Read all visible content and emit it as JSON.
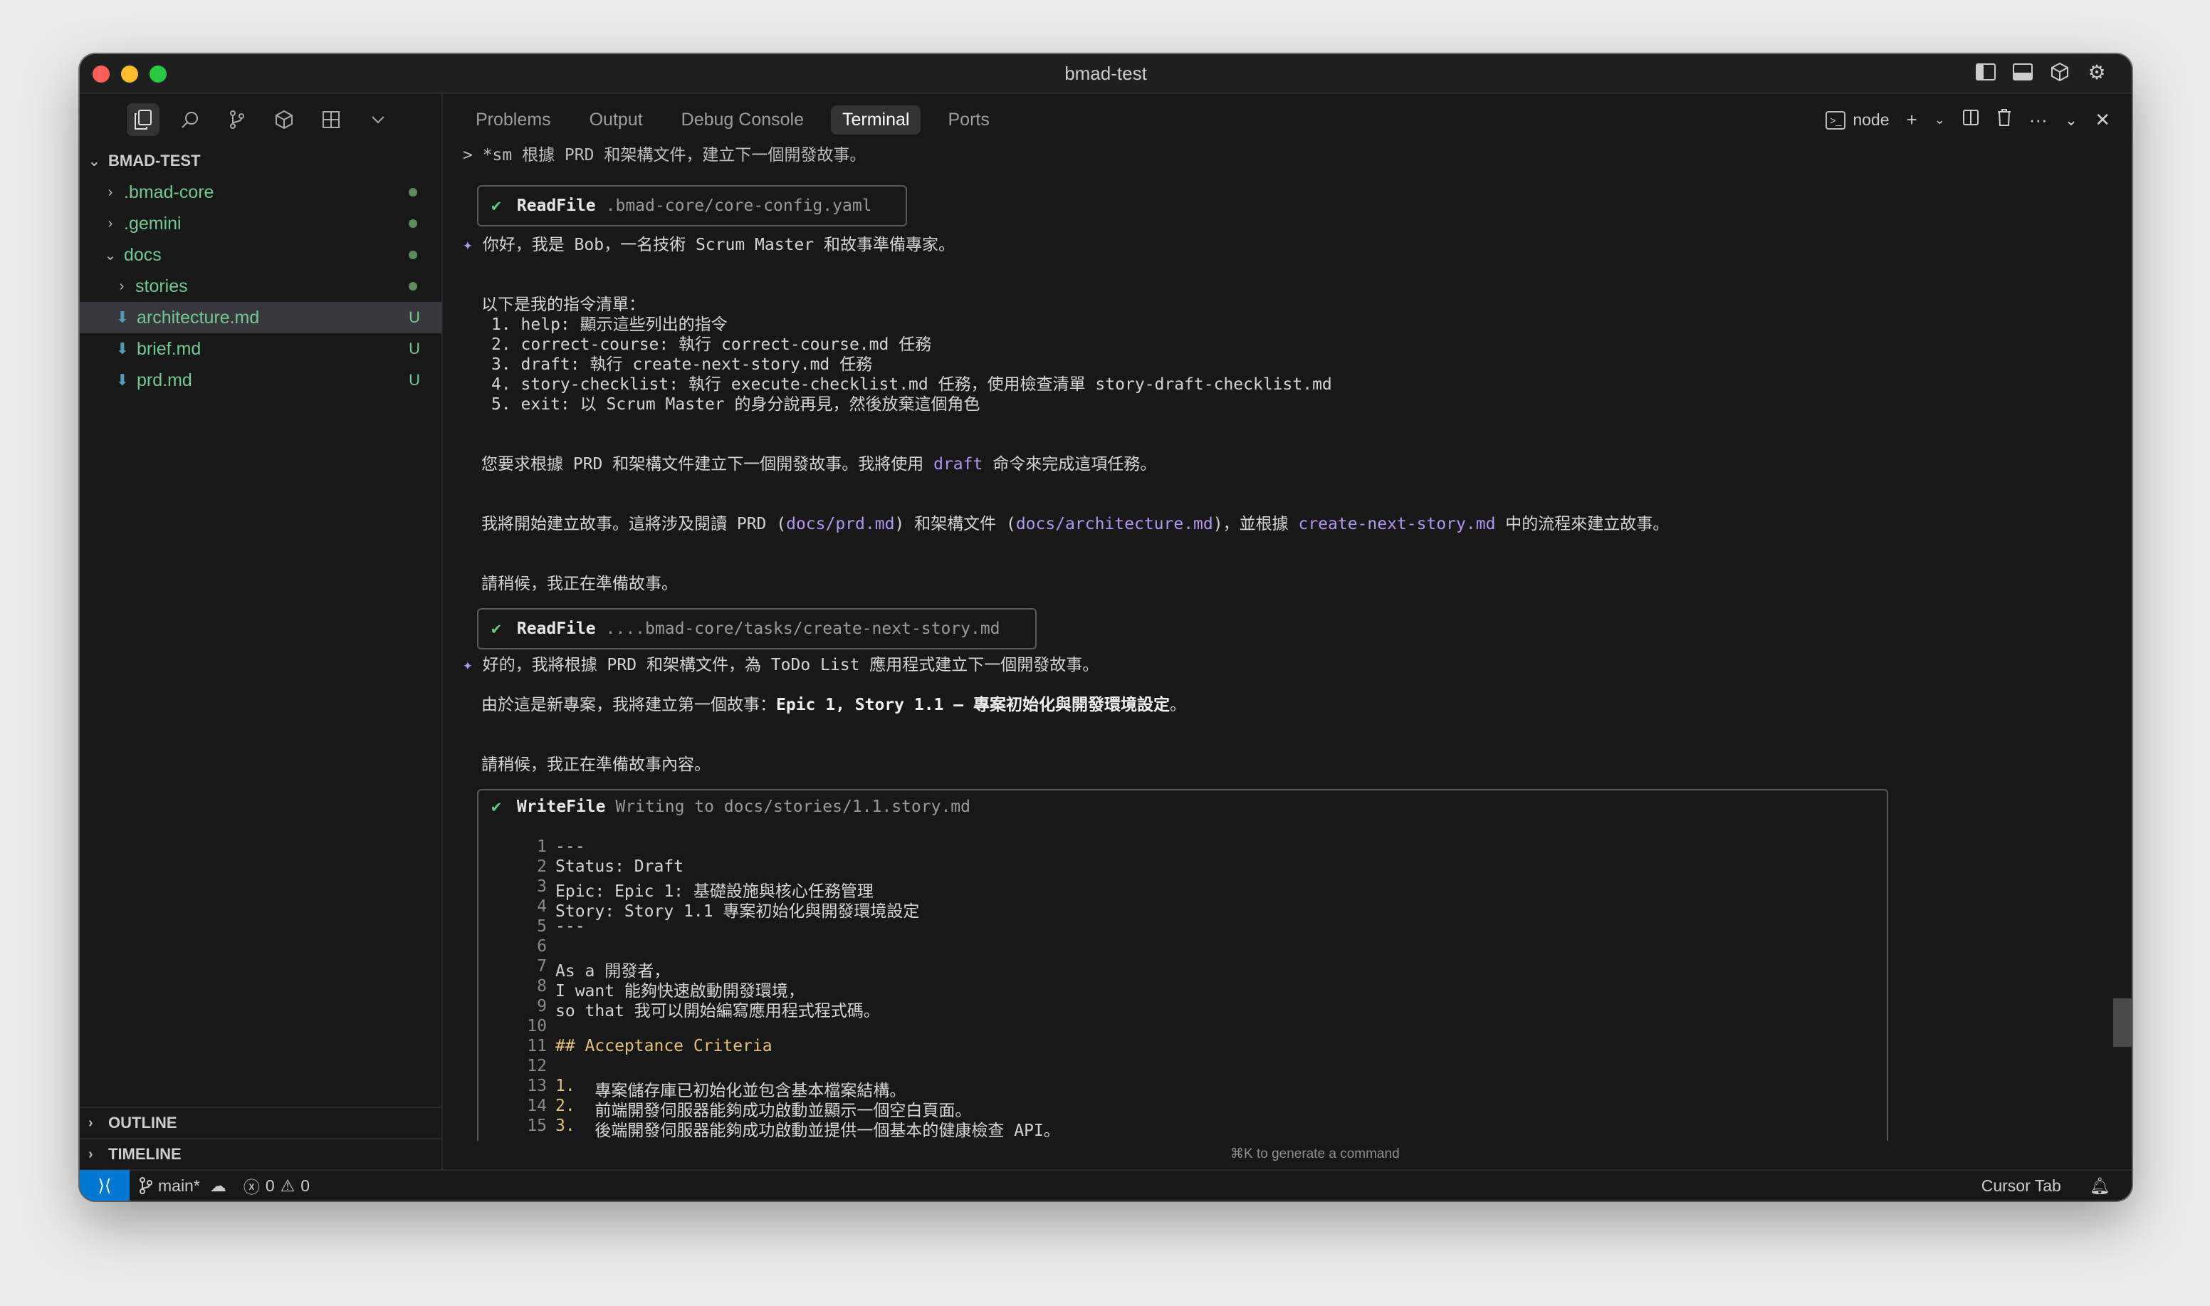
{
  "window": {
    "title": "bmad-test"
  },
  "sidebar": {
    "activity_icons": [
      "files-icon",
      "search-icon",
      "source-control-icon",
      "extensions-icon",
      "layout-icon",
      "chevron-down-icon"
    ],
    "root_label": "BMAD-TEST",
    "items": [
      {
        "label": ".bmad-core",
        "chevron": ">",
        "status": "dot"
      },
      {
        "label": ".gemini",
        "chevron": ">",
        "status": "dot"
      },
      {
        "label": "docs",
        "chevron": "v",
        "status": "dot"
      },
      {
        "label": "stories",
        "chevron": ">",
        "status": "dot"
      },
      {
        "label": "architecture.md",
        "status": "U"
      },
      {
        "label": "brief.md",
        "status": "U"
      },
      {
        "label": "prd.md",
        "status": "U"
      }
    ],
    "outline_label": "OUTLINE",
    "timeline_label": "TIMELINE"
  },
  "panel": {
    "tabs": [
      "Problems",
      "Output",
      "Debug Console",
      "Terminal",
      "Ports"
    ],
    "active_tab": "Terminal",
    "terminal_name": "node"
  },
  "terminal": {
    "prompt": "> *sm 根據 PRD 和架構文件，建立下一個開發故事。",
    "tool1": {
      "check": "✔",
      "name": "ReadFile",
      "arg": ".bmad-core/core-config.yaml"
    },
    "greeting": "你好，我是 Bob，一名技術 Scrum Master 和故事準備專家。",
    "list_title": "以下是我的指令清單：",
    "list": [
      "1. help: 顯示這些列出的指令",
      "2. correct-course: 執行 correct-course.md 任務",
      "3. draft: 執行 create-next-story.md 任務",
      "4. story-checklist: 執行 execute-checklist.md 任務，使用檢查清單 story-draft-checklist.md",
      "5. exit: 以 Scrum Master 的身分說再見，然後放棄這個角色"
    ],
    "para1_a": "您要求根據 PRD 和架構文件建立下一個開發故事。我將使用 ",
    "para1_cmd": "draft",
    "para1_b": " 命令來完成這項任務。",
    "para2_a": "我將開始建立故事。這將涉及閱讀 PRD (",
    "para2_p1": "docs/prd.md",
    "para2_b": ") 和架構文件 (",
    "para2_p2": "docs/architecture.md",
    "para2_c": ")，並根據 ",
    "para2_p3": "create-next-story.md",
    "para2_d": " 中的流程來建立故事。",
    "wait1": "請稍候，我正在準備故事。",
    "tool2": {
      "check": "✔",
      "name": "ReadFile",
      "arg": "....bmad-core/tasks/create-next-story.md"
    },
    "okay": "好的，我將根據 PRD 和架構文件，為 ToDo List 應用程式建立下一個開發故事。",
    "newproj_a": "由於這是新專案，我將建立第一個故事：",
    "newproj_b": "Epic 1, Story 1.1 – 專案初始化與開發環境設定",
    "newproj_c": "。",
    "wait2": "請稍候，我正在準備故事內容。",
    "tool3": {
      "check": "✔",
      "name": "WriteFile",
      "arg": "Writing to docs/stories/1.1.story.md"
    },
    "code": [
      {
        "n": "1",
        "t": "---"
      },
      {
        "n": "2",
        "t": "Status: Draft"
      },
      {
        "n": "3",
        "t": "Epic: Epic 1: 基礎設施與核心任務管理"
      },
      {
        "n": "4",
        "t": "Story: Story 1.1 專案初始化與開發環境設定"
      },
      {
        "n": "5",
        "t": "---"
      },
      {
        "n": "6",
        "t": ""
      },
      {
        "n": "7",
        "t": "As a 開發者，"
      },
      {
        "n": "8",
        "t": "I want 能夠快速啟動開發環境，"
      },
      {
        "n": "9",
        "t": "so that 我可以開始編寫應用程式程式碼。"
      },
      {
        "n": "10",
        "t": ""
      },
      {
        "n": "11",
        "t": "## Acceptance Criteria",
        "kind": "heading"
      },
      {
        "n": "12",
        "t": ""
      },
      {
        "n": "13",
        "num": "1.",
        "t": "  專案儲存庫已初始化並包含基本檔案結構。"
      },
      {
        "n": "14",
        "num": "2.",
        "t": "  前端開發伺服器能夠成功啟動並顯示一個空白頁面。"
      },
      {
        "n": "15",
        "num": "3.",
        "t": "  後端開發伺服器能夠成功啟動並提供一個基本的健康檢查 API。"
      }
    ],
    "hint": "⌘K to generate a command"
  },
  "statusbar": {
    "branch": "main*",
    "errors": "0",
    "warnings": "0",
    "cursor_tab": "Cursor Tab"
  },
  "colors": {
    "accent": "#0078d4",
    "git_untracked": "#73c991",
    "link_purple": "#b294f5"
  }
}
